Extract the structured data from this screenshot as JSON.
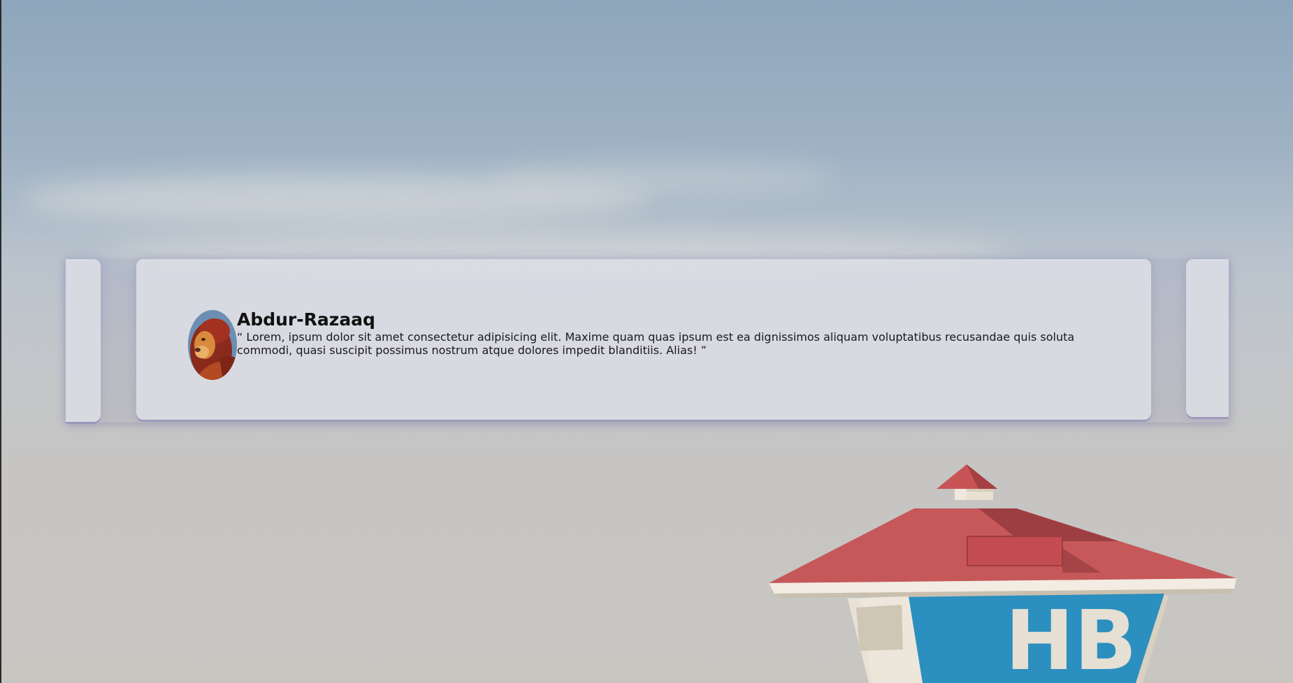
{
  "testimonial": {
    "name": "Abdur-Razaaq",
    "quote": "“ Lorem, ipsum dolor sit amet consectetur adipisicing elit. Maxime quam quas ipsum est ea dignissimos aliquam voluptatibus recusandae quis soluta commodi, quasi suscipit possimus nostrum atque dolores impedit blanditiis. Alias! ”",
    "avatar_icon": "lion-avatar"
  },
  "background": {
    "sign_text": "HB",
    "roof_color": "#c85455",
    "sign_color": "#2b8fbf"
  }
}
